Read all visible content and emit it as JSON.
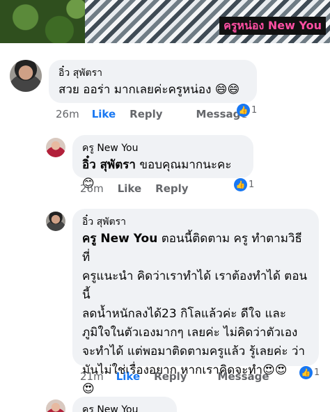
{
  "banner": {
    "tag": "ครูหน่อง New You"
  },
  "comments": [
    {
      "author": "อิ๋ว สุพัตรา",
      "text": "สวย ออร่า มากเลยค่ะครูหน่อง 😄😄",
      "time": "26m",
      "like": "Like",
      "reply": "Reply",
      "message": "Message",
      "reactions": "1"
    },
    {
      "author": "ครู New You",
      "mention": "อิ๋ว สุพัตรา",
      "text": " ขอบคุณมากนะคะ😊",
      "time": "26m",
      "like": "Like",
      "reply": "Reply",
      "reactions": "1"
    },
    {
      "author": "อิ๋ว สุพัตรา",
      "mention": "ครู New You",
      "lines": [
        " ตอนนี้ติดตาม ครู ทำตามวิธีที่",
        "ครูแนะนำ คิดว่าเราทำได้ เราต้องทำได้ ตอนนี้",
        "ลดน้ำหนักลงได้23 กิโลแล้วค่ะ ดีใจ และ",
        "ภูมิใจในตัวเองมากๆ เลยค่ะ ไม่คิดว่าตัวเอง",
        "จะทำได้ แต่พอมาติดตามครูแล้ว รู้เลยค่ะ ว่า",
        "มันไม่ใช่เรื่องอยาก หากเราคิดจะทำ😍😍",
        "😍"
      ],
      "time": "21m",
      "like": "Like",
      "reply": "Reply",
      "message": "Message",
      "reactions": "1"
    },
    {
      "author": "ครู New You"
    }
  ]
}
